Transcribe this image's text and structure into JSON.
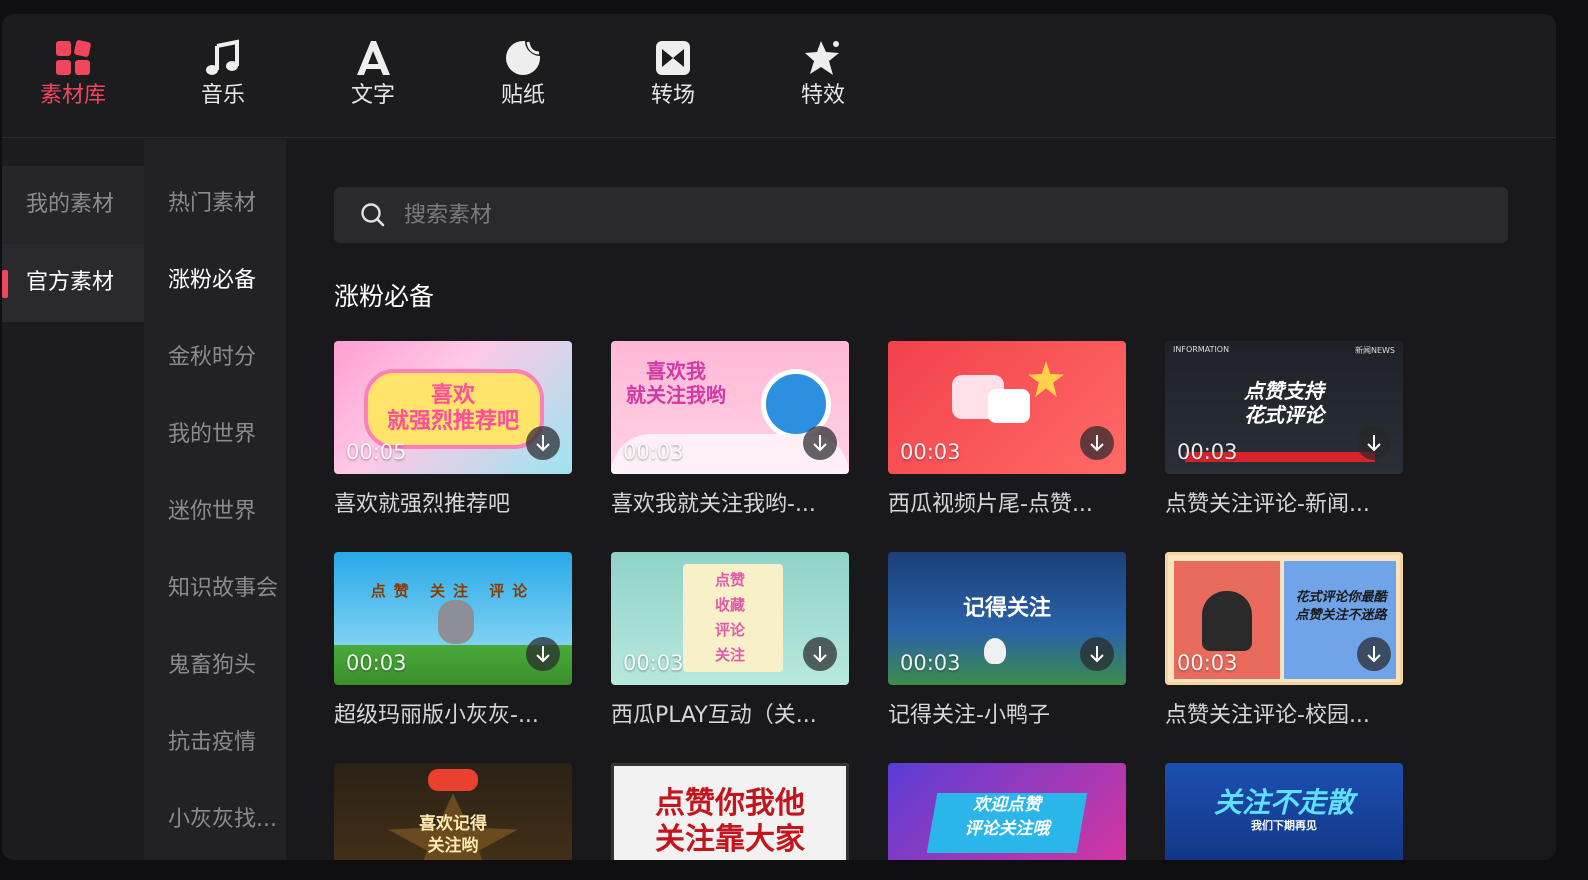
{
  "top_tabs": [
    {
      "label": "素材库",
      "icon": "material-library-icon",
      "active": true
    },
    {
      "label": "音乐",
      "icon": "music-note-icon",
      "active": false
    },
    {
      "label": "文字",
      "icon": "text-a-icon",
      "active": false
    },
    {
      "label": "贴纸",
      "icon": "sticker-icon",
      "active": false
    },
    {
      "label": "转场",
      "icon": "transition-icon",
      "active": false
    },
    {
      "label": "特效",
      "icon": "effects-star-icon",
      "active": false
    }
  ],
  "side_primary": [
    {
      "label": "我的素材"
    },
    {
      "label": "官方素材",
      "active": true
    }
  ],
  "side_secondary": [
    {
      "label": "热门素材"
    },
    {
      "label": "涨粉必备",
      "active": true
    },
    {
      "label": "金秋时分"
    },
    {
      "label": "我的世界"
    },
    {
      "label": "迷你世界"
    },
    {
      "label": "知识故事会"
    },
    {
      "label": "鬼畜狗头"
    },
    {
      "label": "抗击疫情"
    },
    {
      "label": "小灰灰找..."
    }
  ],
  "search": {
    "placeholder": "搜索素材",
    "value": ""
  },
  "section_title": "涨粉必备",
  "cards": [
    {
      "name": "喜欢就强烈推荐吧",
      "duration": "00:05",
      "art_text": "喜欢\n就强烈推荐吧"
    },
    {
      "name": "喜欢我就关注我哟-...",
      "duration": "00:03",
      "art_text": "喜欢我\n就关注我哟"
    },
    {
      "name": "西瓜视频片尾-点赞...",
      "duration": "00:03",
      "art_text": ""
    },
    {
      "name": "点赞关注评论-新闻...",
      "duration": "00:03",
      "art_text": "点赞支持\n花式评论",
      "art_sub_left": "INFORMATION",
      "art_sub_right": "新闻NEWS"
    },
    {
      "name": "超级玛丽版小灰灰-...",
      "duration": "00:03",
      "art_text": "点赞 关注 评论"
    },
    {
      "name": "西瓜PLAY互动（关...",
      "duration": "00:03",
      "art_text": "点赞\n收藏\n评论\n关注"
    },
    {
      "name": "记得关注-小鸭子",
      "duration": "00:03",
      "art_text": "记得关注"
    },
    {
      "name": "点赞关注评论-校园...",
      "duration": "00:03",
      "art_text": "花式评论你最酷\n点赞关注不迷路"
    },
    {
      "name": "",
      "duration": "",
      "art_text": "喜欢记得\n关注哟"
    },
    {
      "name": "",
      "duration": "",
      "art_text": "点赞你我他\n关注靠大家"
    },
    {
      "name": "",
      "duration": "",
      "art_text": "欢迎点赞\n评论关注哦"
    },
    {
      "name": "",
      "duration": "",
      "art_text": "关注不走散",
      "art_sub": "我们下期再见"
    }
  ],
  "colors": {
    "accent": "#f0465c",
    "bg": "#1c1c1f",
    "panel": "#222226",
    "search_bg": "#2a2a2e"
  }
}
